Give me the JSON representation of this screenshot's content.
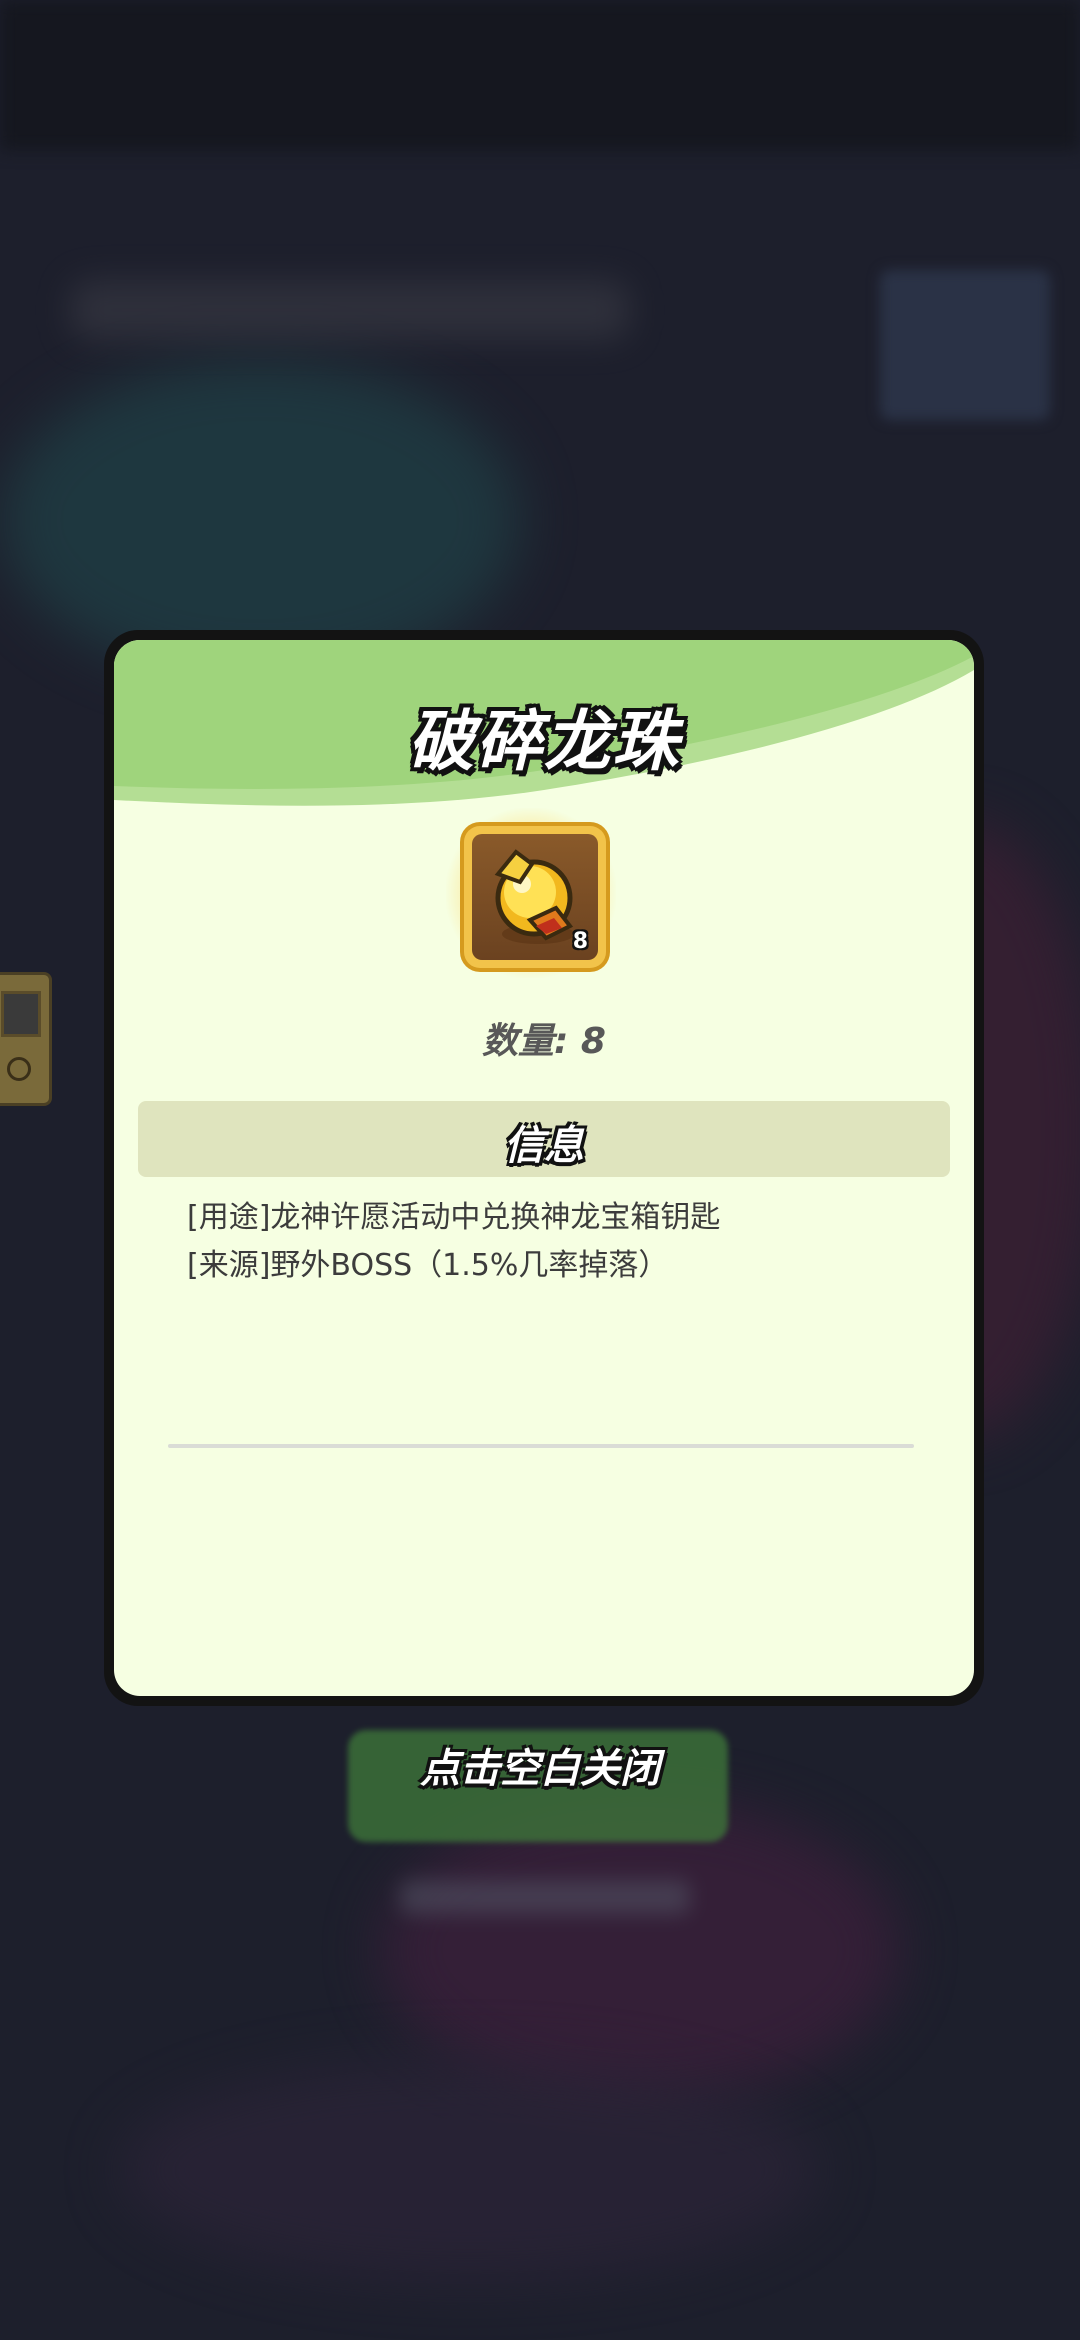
{
  "dialog": {
    "title": "破碎龙珠",
    "item": {
      "icon": "broken-dragon-ball-icon",
      "count": "8"
    },
    "quantity_text": "数量: 8",
    "info_header": "信息",
    "description": {
      "usage": "[用途]龙神许愿活动中兑换神龙宝箱钥匙",
      "source": "[来源]野外BOSS（1.5%几率掉落）"
    }
  },
  "close_hint": "点击空白关闭",
  "colors": {
    "dialog_background": "#f6ffe2",
    "header_green": "#9fd47c",
    "info_bar": "#dfe4be",
    "item_frame": "#f2c34a"
  }
}
